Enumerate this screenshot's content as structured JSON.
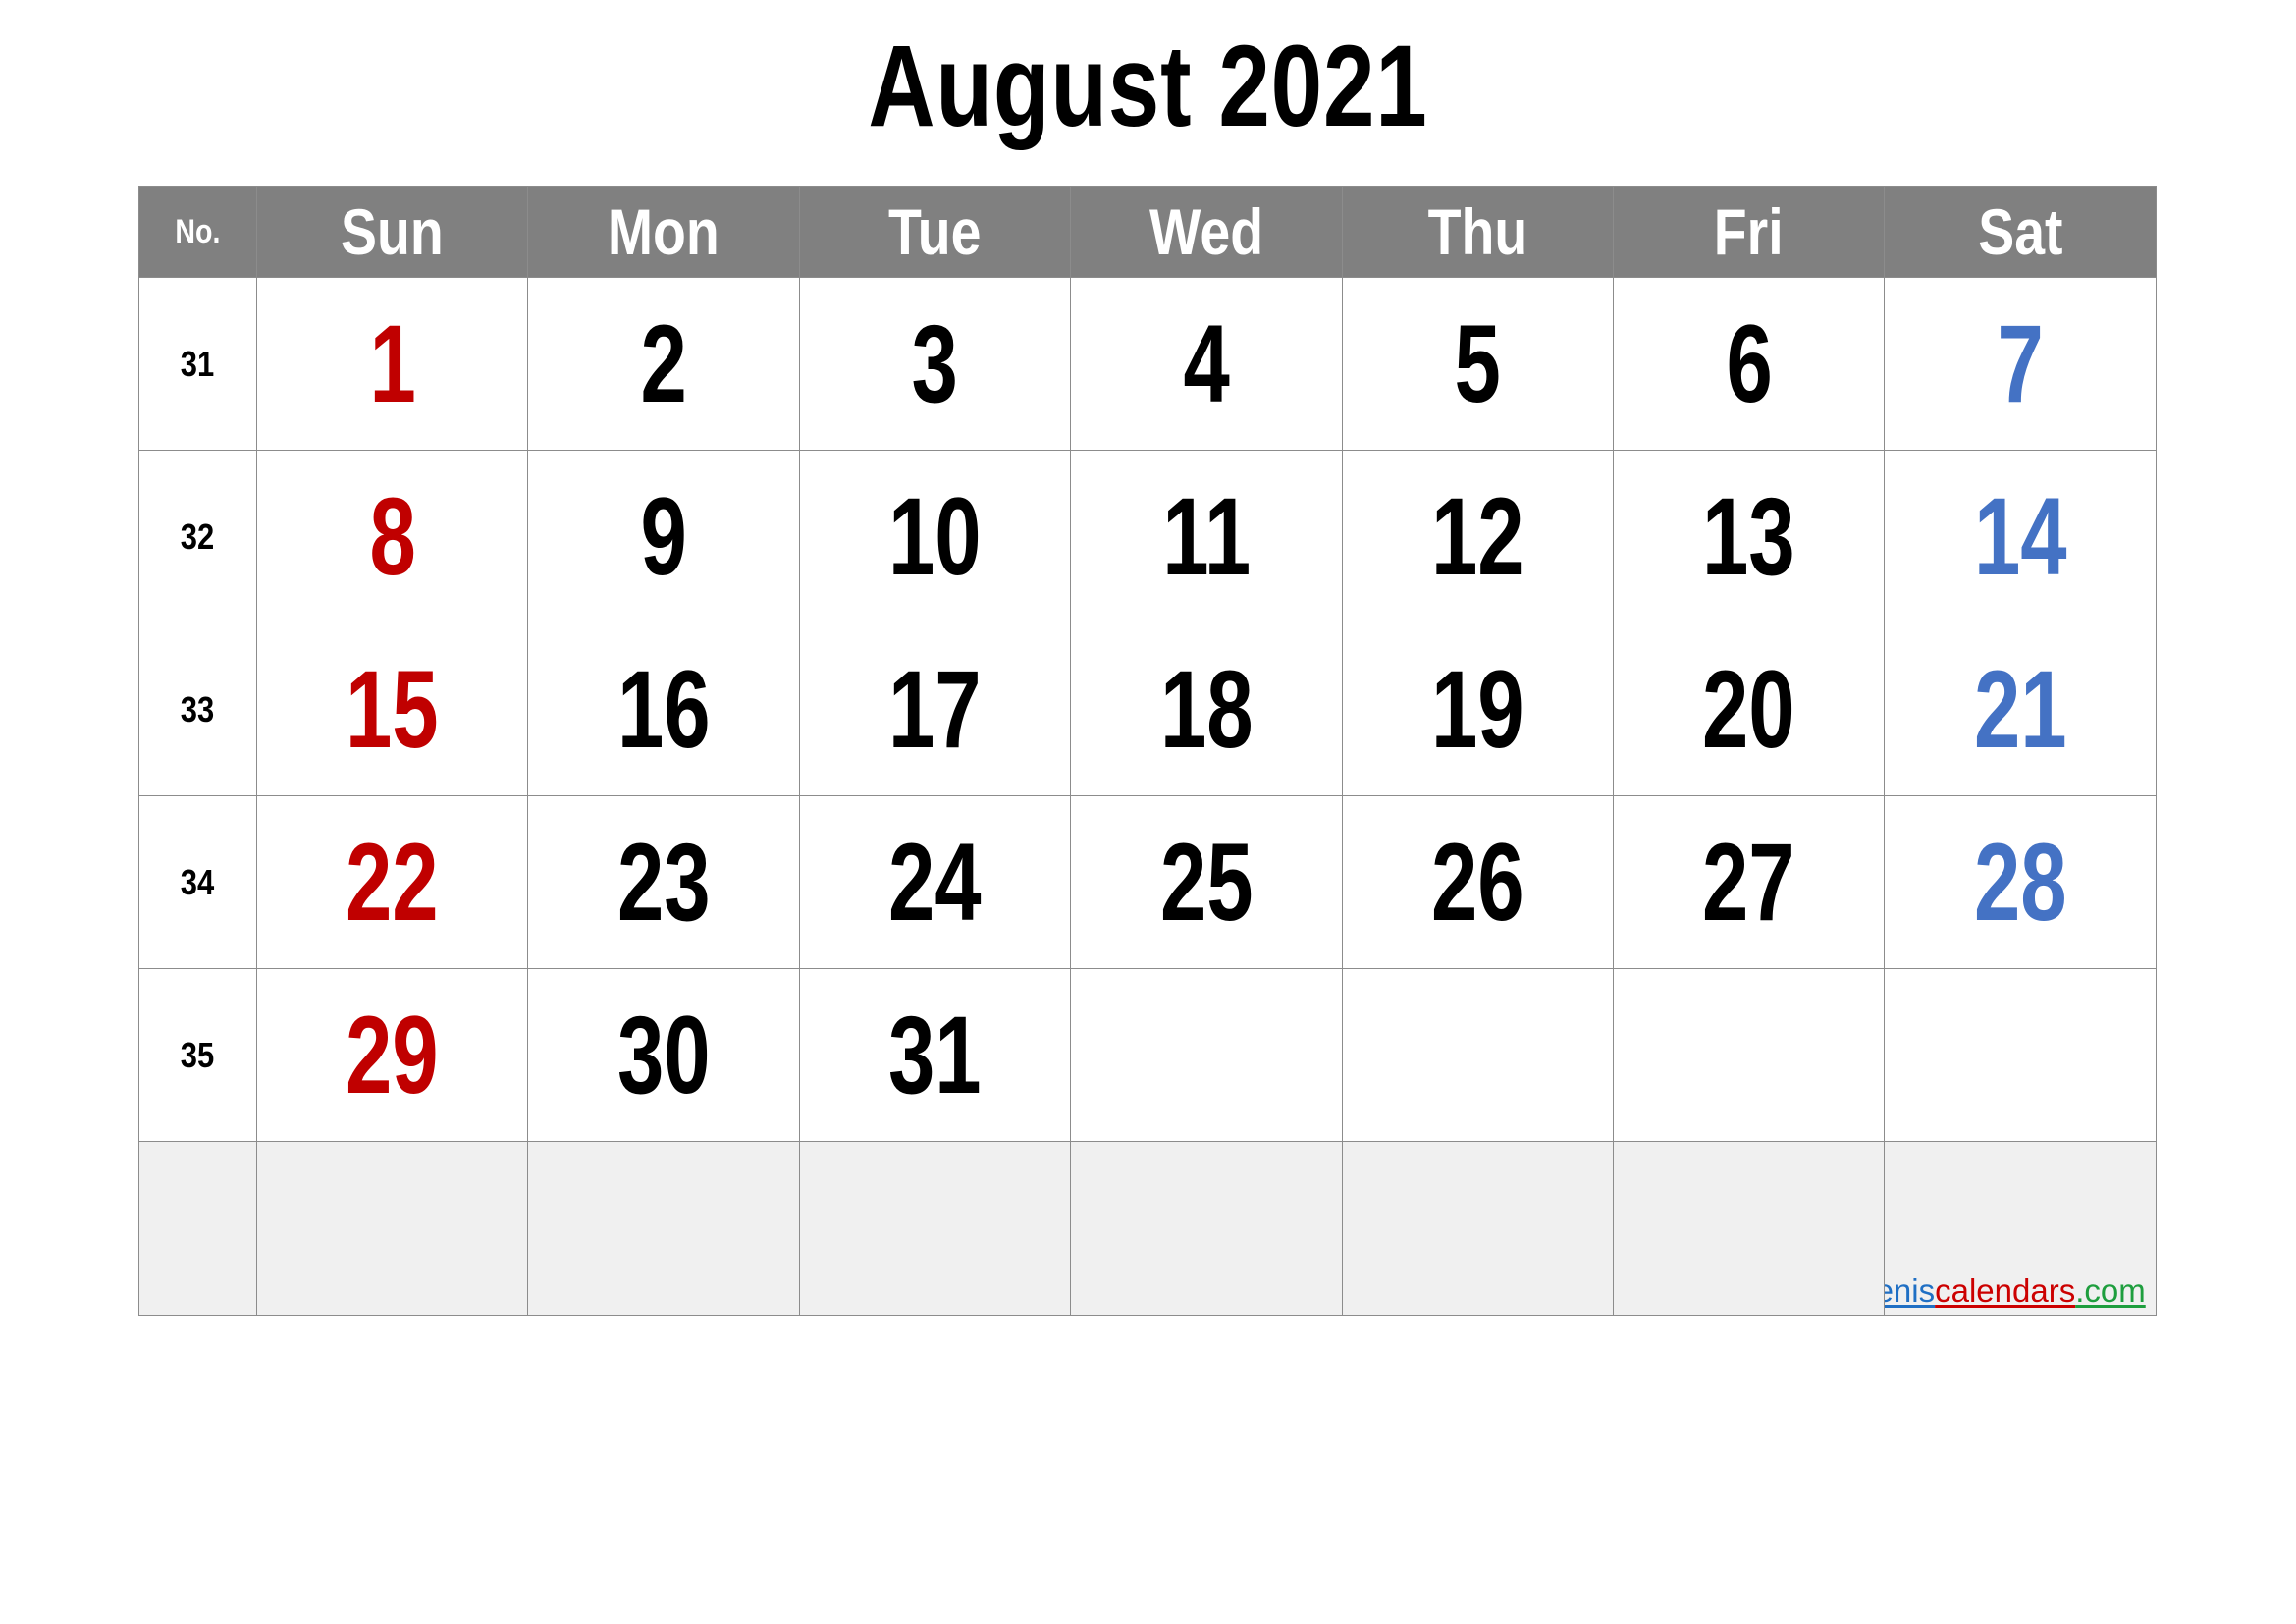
{
  "title": "August 2021",
  "month": "August",
  "year": "2021",
  "colors": {
    "header_background": "#808080",
    "header_text": "#ffffff",
    "sunday": "#c00000",
    "saturday": "#4472c4",
    "weekday": "#000000",
    "empty_cell": "#f0f0f0",
    "grid_line": "#8c8c8c"
  },
  "header": {
    "week_number_label": "No.",
    "days": [
      "Sun",
      "Mon",
      "Tue",
      "Wed",
      "Thu",
      "Fri",
      "Sat"
    ]
  },
  "weeks": [
    {
      "no": "31",
      "days": [
        {
          "date": "1",
          "kind": "sunday"
        },
        {
          "date": "2",
          "kind": "weekday"
        },
        {
          "date": "3",
          "kind": "weekday"
        },
        {
          "date": "4",
          "kind": "weekday"
        },
        {
          "date": "5",
          "kind": "weekday"
        },
        {
          "date": "6",
          "kind": "weekday"
        },
        {
          "date": "7",
          "kind": "saturday"
        }
      ]
    },
    {
      "no": "32",
      "days": [
        {
          "date": "8",
          "kind": "sunday"
        },
        {
          "date": "9",
          "kind": "weekday"
        },
        {
          "date": "10",
          "kind": "weekday"
        },
        {
          "date": "11",
          "kind": "weekday"
        },
        {
          "date": "12",
          "kind": "weekday"
        },
        {
          "date": "13",
          "kind": "weekday"
        },
        {
          "date": "14",
          "kind": "saturday"
        }
      ]
    },
    {
      "no": "33",
      "days": [
        {
          "date": "15",
          "kind": "sunday"
        },
        {
          "date": "16",
          "kind": "weekday"
        },
        {
          "date": "17",
          "kind": "weekday"
        },
        {
          "date": "18",
          "kind": "weekday"
        },
        {
          "date": "19",
          "kind": "weekday"
        },
        {
          "date": "20",
          "kind": "weekday"
        },
        {
          "date": "21",
          "kind": "saturday"
        }
      ]
    },
    {
      "no": "34",
      "days": [
        {
          "date": "22",
          "kind": "sunday"
        },
        {
          "date": "23",
          "kind": "weekday"
        },
        {
          "date": "24",
          "kind": "weekday"
        },
        {
          "date": "25",
          "kind": "weekday"
        },
        {
          "date": "26",
          "kind": "weekday"
        },
        {
          "date": "27",
          "kind": "weekday"
        },
        {
          "date": "28",
          "kind": "saturday"
        }
      ]
    },
    {
      "no": "35",
      "days": [
        {
          "date": "29",
          "kind": "sunday"
        },
        {
          "date": "30",
          "kind": "weekday"
        },
        {
          "date": "31",
          "kind": "weekday"
        },
        {
          "date": "",
          "kind": "empty"
        },
        {
          "date": "",
          "kind": "empty"
        },
        {
          "date": "",
          "kind": "empty"
        },
        {
          "date": "",
          "kind": "empty"
        }
      ]
    },
    {
      "no": "",
      "blank": true,
      "days": [
        {
          "date": "",
          "kind": "empty"
        },
        {
          "date": "",
          "kind": "empty"
        },
        {
          "date": "",
          "kind": "empty"
        },
        {
          "date": "",
          "kind": "empty"
        },
        {
          "date": "",
          "kind": "empty"
        },
        {
          "date": "",
          "kind": "empty"
        },
        {
          "date": "",
          "kind": "empty"
        }
      ]
    }
  ],
  "watermark": {
    "part1": "whenis",
    "part2": "calendars",
    "part3": ".com"
  }
}
